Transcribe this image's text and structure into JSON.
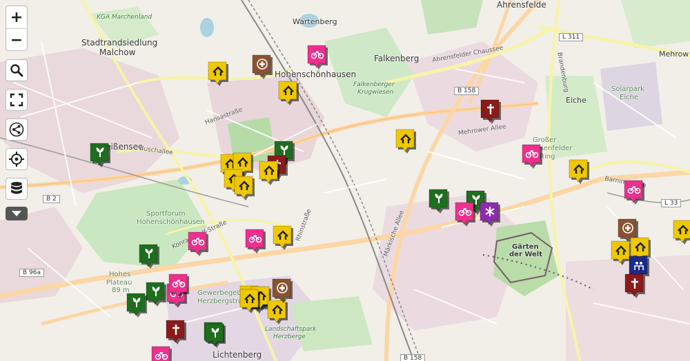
{
  "controls": {
    "zoom_in": "+",
    "zoom_out": "−"
  },
  "colors": {
    "fitness": "#f0c800",
    "bicycle": "#ee2f8e",
    "plant": "#1f6e1f",
    "medical": "#8a5230",
    "cross": "#8b1a1a",
    "star": "#8e2bb0",
    "blue": "#1a2a8a"
  },
  "places": [
    {
      "name": "Ahrensfelde",
      "cls": "big"
    },
    {
      "name": "Wartenberg",
      "cls": ""
    },
    {
      "name": "Stadtrandsiedlung",
      "cls": "big"
    },
    {
      "name": "Malchow",
      "cls": "big"
    },
    {
      "name": "KGA Marchenland",
      "cls": "green"
    },
    {
      "name": "Hohenschönhausen",
      "cls": "big"
    },
    {
      "name": "Falkenberg",
      "cls": "big"
    },
    {
      "name": "Falkenberger",
      "cls": "green"
    },
    {
      "name": "Krugwiesen",
      "cls": "green"
    },
    {
      "name": "Eiche",
      "cls": ""
    },
    {
      "name": "Mehrow",
      "cls": ""
    },
    {
      "name": "Solarpark",
      "cls": "park"
    },
    {
      "name": "Eiche",
      "cls": "park"
    },
    {
      "name": "Weißensee",
      "cls": "big"
    },
    {
      "name": "Sportforum",
      "cls": "park"
    },
    {
      "name": "Hohenschönhausen",
      "cls": "park"
    },
    {
      "name": "Hohes",
      "cls": "park"
    },
    {
      "name": "Plateau",
      "cls": "park"
    },
    {
      "name": "89 m",
      "cls": "park"
    },
    {
      "name": "Gewerbegebiet",
      "cls": "park"
    },
    {
      "name": "Herzbergstraße",
      "cls": "park"
    },
    {
      "name": "Landschaftspark",
      "cls": "green"
    },
    {
      "name": "Herzberge",
      "cls": "green"
    },
    {
      "name": "Lichtenberg",
      "cls": "big"
    },
    {
      "name": "Gärten",
      "cls": ""
    },
    {
      "name": "der Welt",
      "cls": ""
    },
    {
      "name": "Großer",
      "cls": "park"
    },
    {
      "name": "Rosenfelder",
      "cls": "park"
    },
    {
      "name": "Ring",
      "cls": "park"
    },
    {
      "name": "Mehrower Allee",
      "cls": "road"
    },
    {
      "name": "Ahrensfelder Chaussee",
      "cls": "road"
    },
    {
      "name": "Buschallee",
      "cls": "road"
    },
    {
      "name": "Hansastraße",
      "cls": "road"
    },
    {
      "name": "Barnimstraße",
      "cls": "road"
    },
    {
      "name": "Brandenburg",
      "cls": "road"
    },
    {
      "name": "Märkische Allee",
      "cls": "road"
    },
    {
      "name": "Konrad-Wolf-Straße",
      "cls": "road"
    },
    {
      "name": "Rhinstraße",
      "cls": "road"
    }
  ],
  "shields": [
    "L 311",
    "B 158",
    "B 2",
    "L 33",
    "B 96a",
    "B 158"
  ],
  "markers": [
    {
      "kind": "fitness",
      "color": "#f0c800"
    },
    {
      "kind": "medical",
      "color": "#8a5230"
    },
    {
      "kind": "bicycle",
      "color": "#ee2f8e"
    },
    {
      "kind": "fitness",
      "color": "#f0c800"
    },
    {
      "kind": "plant",
      "color": "#1f6e1f"
    },
    {
      "kind": "cross",
      "color": "#8b1a1a"
    },
    {
      "kind": "fitness",
      "color": "#f0c800"
    },
    {
      "kind": "bicycle",
      "color": "#ee2f8e"
    },
    {
      "kind": "fitness",
      "color": "#f0c800"
    },
    {
      "kind": "plant",
      "color": "#1f6e1f"
    },
    {
      "kind": "fitness",
      "color": "#f0c800"
    },
    {
      "kind": "fitness",
      "color": "#f0c800"
    },
    {
      "kind": "cross",
      "color": "#8b1a1a"
    },
    {
      "kind": "fitness",
      "color": "#f0c800"
    },
    {
      "kind": "fitness",
      "color": "#f0c800"
    },
    {
      "kind": "fitness",
      "color": "#f0c800"
    },
    {
      "kind": "bicycle",
      "color": "#ee2f8e"
    },
    {
      "kind": "plant",
      "color": "#1f6e1f"
    },
    {
      "kind": "plant",
      "color": "#1f6e1f"
    },
    {
      "kind": "bicycle",
      "color": "#ee2f8e"
    },
    {
      "kind": "star",
      "color": "#8e2bb0"
    },
    {
      "kind": "bicycle",
      "color": "#ee2f8e"
    },
    {
      "kind": "plant",
      "color": "#1f6e1f"
    },
    {
      "kind": "medical",
      "color": "#8a5230"
    },
    {
      "kind": "fitness",
      "color": "#f0c800"
    },
    {
      "kind": "fitness",
      "color": "#f0c800"
    },
    {
      "kind": "fitness",
      "color": "#f0c800"
    },
    {
      "kind": "blue",
      "color": "#1a2a8a"
    },
    {
      "kind": "cross",
      "color": "#8b1a1a"
    },
    {
      "kind": "bicycle",
      "color": "#ee2f8e"
    },
    {
      "kind": "fitness",
      "color": "#f0c800"
    },
    {
      "kind": "plant",
      "color": "#1f6e1f"
    },
    {
      "kind": "bicycle",
      "color": "#ee2f8e"
    },
    {
      "kind": "fitness",
      "color": "#f0c800"
    },
    {
      "kind": "plant",
      "color": "#1f6e1f"
    },
    {
      "kind": "bicycle",
      "color": "#ee2f8e"
    },
    {
      "kind": "plant",
      "color": "#1f6e1f"
    },
    {
      "kind": "plant",
      "color": "#1f6e1f"
    },
    {
      "kind": "fitness",
      "color": "#f0c800"
    },
    {
      "kind": "fitness",
      "color": "#f0c800"
    },
    {
      "kind": "medical",
      "color": "#8a5230"
    },
    {
      "kind": "fitness",
      "color": "#f0c800"
    },
    {
      "kind": "cross",
      "color": "#8b1a1a"
    },
    {
      "kind": "plant",
      "color": "#1f6e1f"
    },
    {
      "kind": "bicycle",
      "color": "#ee2f8e"
    }
  ]
}
